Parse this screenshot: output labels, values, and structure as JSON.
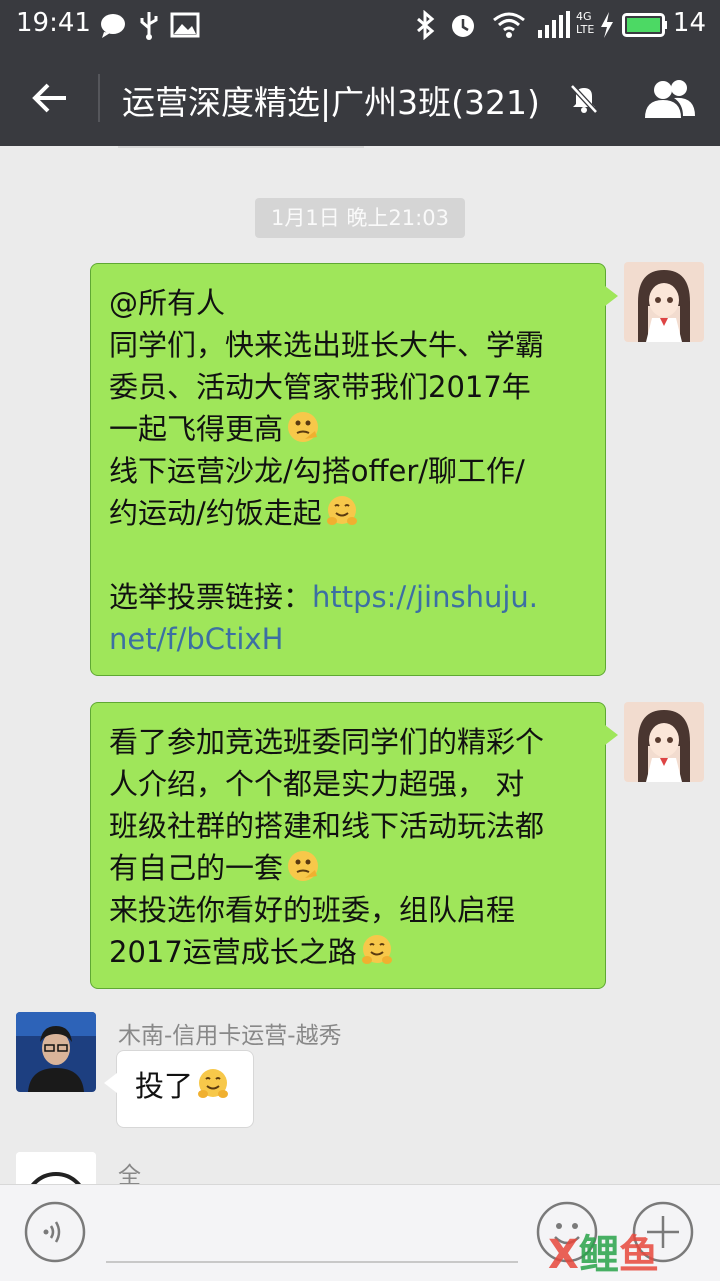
{
  "status_bar": {
    "time": "19:41",
    "network": "4G LTE",
    "battery": "14",
    "icons": [
      "chat-bubble-icon",
      "usb-icon",
      "image-icon",
      "bluetooth-icon",
      "alarm-icon",
      "wifi-icon",
      "signal-icon",
      "charging-icon",
      "battery-icon"
    ]
  },
  "header": {
    "title": "运营深度精选|广州3班(321)",
    "icons": [
      "back-arrow-icon",
      "mute-bell-icon",
      "group-members-icon"
    ]
  },
  "chat": {
    "timestamp": "1月1日 晚上21:03",
    "messages": [
      {
        "side": "right",
        "lines": [
          "@所有人",
          "同学们，快来选出班长大牛、学霸",
          "委员、活动大管家带我们2017年",
          "一起飞得更高",
          "线下运营沙龙/勾搭offer/聊工作/",
          "约运动/约饭走起",
          "",
          "选举投票链接：",
          "https://jinshuju.",
          "net/f/bCtixH"
        ]
      },
      {
        "side": "right",
        "lines": [
          "看了参加竞选班委同学们的精彩个",
          "人介绍，个个都是实力超强， 对",
          "班级社群的搭建和线下活动玩法都",
          "有自己的一套",
          "来投选你看好的班委，组队启程",
          "2017运营成长之路"
        ]
      },
      {
        "side": "left",
        "sender": "木南-信用卡运营-越秀",
        "text": "投了"
      },
      {
        "side": "left",
        "sender": "全"
      }
    ]
  },
  "input_bar": {
    "icons": [
      "voice-icon",
      "emoji-icon",
      "plus-icon"
    ]
  },
  "watermark": {
    "part1": "X",
    "part2": "鲤",
    "part3": "鱼"
  },
  "colors": {
    "bar": "#393a3f",
    "bg": "#ebebeb",
    "bubble_self": "#9fe65a",
    "link": "#3c6fa3"
  }
}
